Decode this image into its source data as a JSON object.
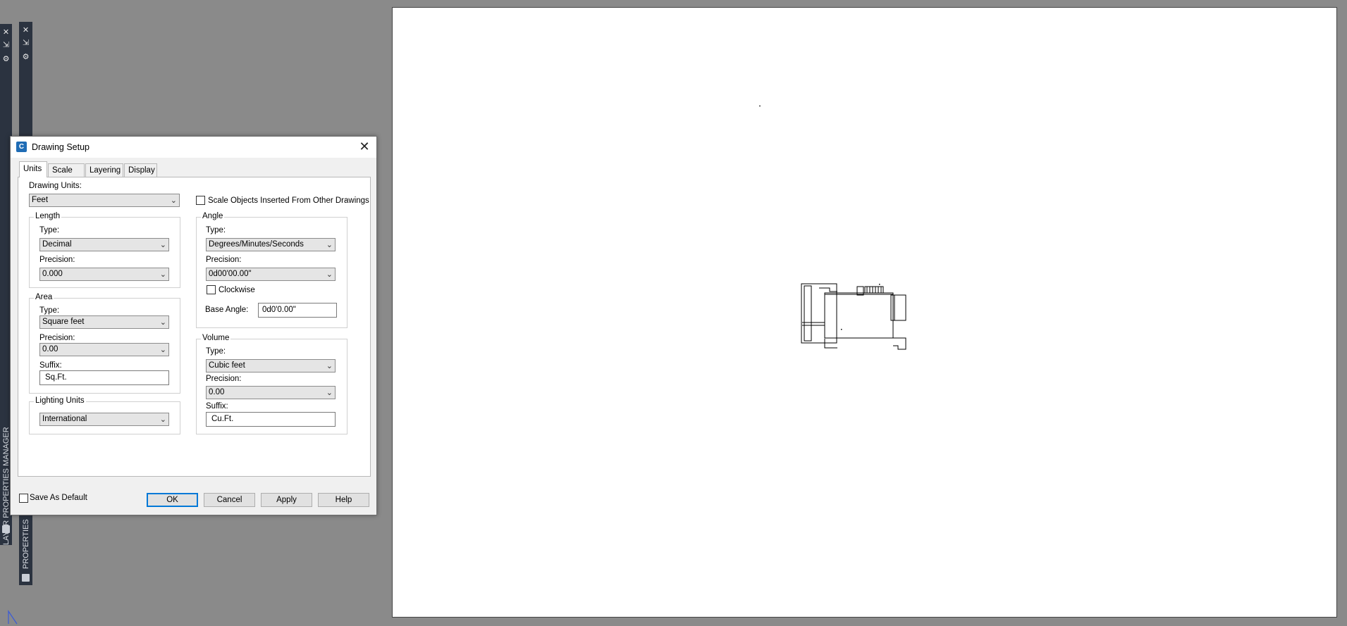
{
  "palettes": {
    "layer_palette": {
      "close": "✕",
      "pin": "⇲",
      "settings": "⚙",
      "label": "LAYER PROPERTIES MANAGER"
    },
    "properties_palette": {
      "close": "✕",
      "pin": "⇲",
      "settings": "⚙",
      "label": "PROPERTIES"
    }
  },
  "dialog": {
    "title": "Drawing Setup",
    "close": "✕",
    "tabs": [
      {
        "label": "Units",
        "active": true
      },
      {
        "label": "Scale",
        "active": false
      },
      {
        "label": "Layering",
        "active": false
      },
      {
        "label": "Display",
        "active": false
      }
    ],
    "drawing_units": {
      "label": "Drawing Units:",
      "value": "Feet"
    },
    "scale_objects": {
      "label": "Scale Objects Inserted From Other Drawings",
      "checked": false
    },
    "length": {
      "title": "Length",
      "type_label": "Type:",
      "type_value": "Decimal",
      "precision_label": "Precision:",
      "precision_value": "0.000"
    },
    "area": {
      "title": "Area",
      "type_label": "Type:",
      "type_value": "Square feet",
      "precision_label": "Precision:",
      "precision_value": "0.00",
      "suffix_label": "Suffix:",
      "suffix_value": "Sq.Ft."
    },
    "lighting": {
      "title": "Lighting Units",
      "value": "International"
    },
    "angle": {
      "title": "Angle",
      "type_label": "Type:",
      "type_value": "Degrees/Minutes/Seconds",
      "precision_label": "Precision:",
      "precision_value": "0d00'00.00\"",
      "clockwise_label": "Clockwise",
      "clockwise_checked": false,
      "base_angle_label": "Base Angle:",
      "base_angle_value": "0d0'0.00\""
    },
    "volume": {
      "title": "Volume",
      "type_label": "Type:",
      "type_value": "Cubic feet",
      "precision_label": "Precision:",
      "precision_value": "0.00",
      "suffix_label": "Suffix:",
      "suffix_value": "Cu.Ft."
    },
    "save_default": {
      "label": "Save As Default",
      "checked": false
    },
    "buttons": {
      "ok": "OK",
      "cancel": "Cancel",
      "apply": "Apply",
      "help": "Help"
    }
  },
  "colors": {
    "canvas_bg": "#8a8a8a",
    "palette_bar": "#2b3340",
    "accent": "#0078d7",
    "paper": "#ffffff"
  }
}
